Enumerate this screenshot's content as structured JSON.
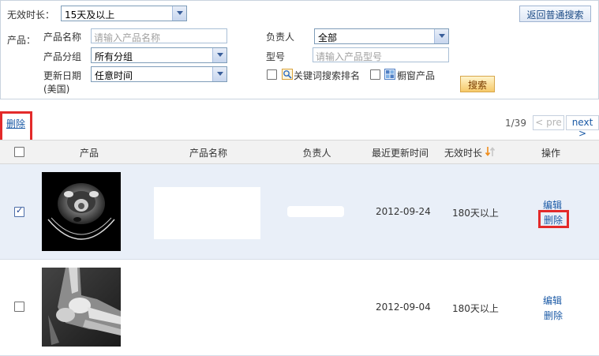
{
  "search": {
    "invalid_duration_label": "无效时长：",
    "invalid_duration_value": "15天及以上",
    "return_button": "返回普通搜索",
    "product_section_label": "产品：",
    "product_name_label": "产品名称",
    "product_name_placeholder": "请输入产品名称",
    "owner_label": "负责人",
    "owner_value": "全部",
    "product_group_label": "产品分组",
    "product_group_value": "所有分组",
    "model_label": "型号",
    "model_placeholder": "请输入产品型号",
    "update_date_label": "更新日期",
    "update_date_tz": "(美国)",
    "update_date_value": "任意时间",
    "keyword_rank_label": "关键词搜索排名",
    "showcase_label": "橱窗产品",
    "search_button": "搜索"
  },
  "toolbar": {
    "delete_label": "删除",
    "page_info": "1/39",
    "prev_label": "< pre",
    "next_label": "next >"
  },
  "table": {
    "headers": {
      "product": "产品",
      "product_name": "产品名称",
      "owner": "负责人",
      "last_updated": "最近更新时间",
      "invalid_duration": "无效时长",
      "actions": "操作"
    },
    "rows": [
      {
        "date": "2012-09-24",
        "duration": "180天以上",
        "edit": "编辑",
        "delete": "删除",
        "checked": true
      },
      {
        "date": "2012-09-04",
        "duration": "180天以上",
        "edit": "编辑",
        "delete": "删除",
        "checked": false
      }
    ]
  },
  "colors": {
    "link": "#1b5aa6",
    "highlight_red": "#e32a2a",
    "selected_row": "#e9eff8",
    "sort_arrow": "#f08c1a"
  },
  "icons": {
    "keyword_rank": "magnifier-chart-icon",
    "showcase": "grid-window-icon",
    "sort": "sort-arrows-icon"
  }
}
